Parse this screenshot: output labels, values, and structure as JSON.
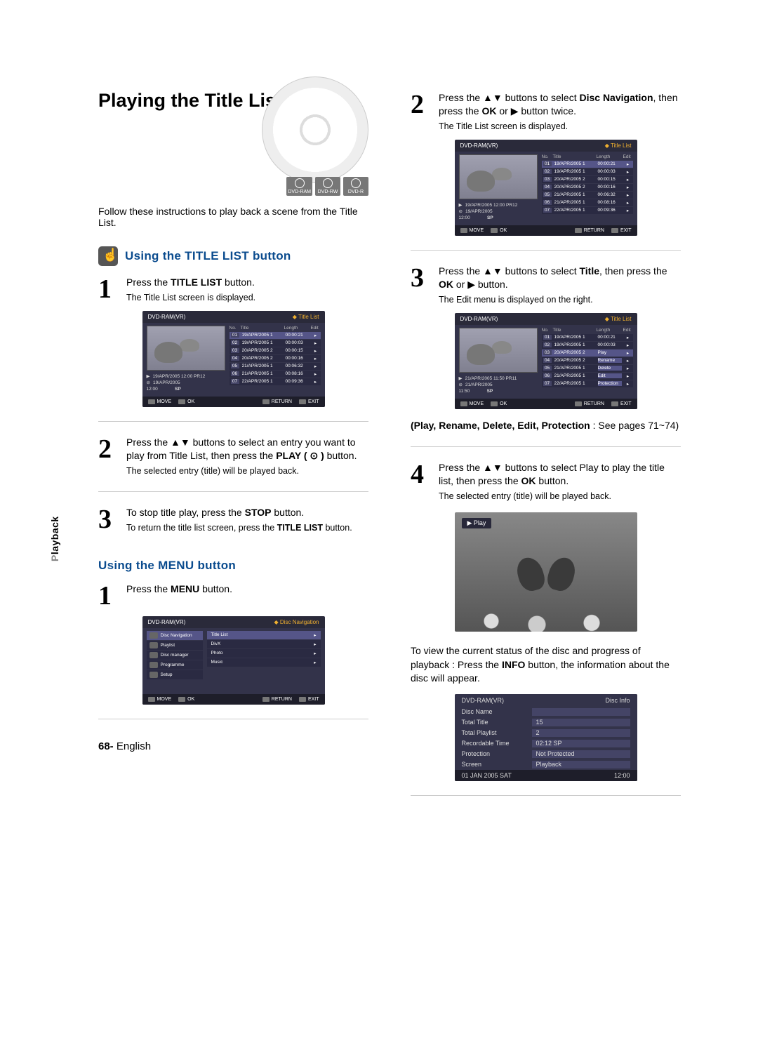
{
  "sideTab": {
    "faded": "P",
    "active": "layback"
  },
  "pageTitle": "Playing the Title List",
  "badges": [
    "DVD-RAM",
    "DVD-RW",
    "DVD-R"
  ],
  "intro": "Follow these instructions to play back a scene from the Title List.",
  "sectionA": "Using the TITLE LIST button",
  "sectionB": "Using the MENU button",
  "pageFooter": {
    "num": "68-",
    "lang": "English"
  },
  "col1": {
    "step1": {
      "num": "1",
      "text_pre": "Press the ",
      "text_bold": "TITLE LIST",
      "text_post": " button.",
      "sub": "The Title List screen is displayed."
    },
    "step2": {
      "num": "2",
      "text": "Press the ▲▼ buttons to select an entry you want to play from Title List, then press the ",
      "bold": "PLAY ( ⊙ )",
      "text2": " button.",
      "sub": "The selected entry (title) will be played back."
    },
    "step3": {
      "num": "3",
      "text": "To stop title play, press the ",
      "bold": "STOP",
      "text2": " button.",
      "sub_pre": "To return the title list screen, press the ",
      "sub_bold": "TITLE LIST",
      "sub_post": " button."
    },
    "stepB1": {
      "num": "1",
      "text": "Press the ",
      "bold": "MENU",
      "text2": " button."
    }
  },
  "col2": {
    "step2": {
      "num": "2",
      "text": "Press the ▲▼ buttons to select ",
      "bold1": "Disc Navigation",
      "mid": ", then press the ",
      "bold2": "OK",
      "text2": " or ▶ button twice.",
      "sub": "The Title List screen is displayed."
    },
    "step3": {
      "num": "3",
      "text": "Press the ▲▼ buttons to select ",
      "bold1": "Title",
      "mid": ", then press the ",
      "bold2": "OK",
      "text2": " or ▶ button.",
      "sub": "The Edit menu is displayed on the right."
    },
    "note": {
      "bold": "(Play, Rename, Delete, Edit, Protection",
      "rest": " : See pages 71~74)"
    },
    "step4": {
      "num": "4",
      "text": "Press the ▲▼ buttons to select Play to play the title list, then press the ",
      "bold": "OK",
      "text2": " button.",
      "sub": "The selected entry (title) will be played back."
    },
    "playLabel": "▶ Play",
    "infoNote": "To view the current status of the disc and progress of playback : Press the ",
    "infoBold": "INFO",
    "infoNote2": " button, the information about the disc will appear."
  },
  "titlelist_ui": {
    "header_left": "DVD-RAM(VR)",
    "header_right": "Title List",
    "list_head": {
      "no": "No.",
      "title": "Title",
      "length": "Length",
      "edit": "Edit"
    },
    "meta": {
      "line1": "19/APR/2005 12:00 PR12",
      "line2": "19/APR/2005",
      "line3_a": "12:00",
      "line3_b": "SP"
    },
    "rows": [
      {
        "n": "01",
        "t": "19/APR/2005 1",
        "l": "00:00:21",
        "sel": true
      },
      {
        "n": "02",
        "t": "19/APR/2005 1",
        "l": "00:00:03"
      },
      {
        "n": "03",
        "t": "20/APR/2005 2",
        "l": "00:00:15"
      },
      {
        "n": "04",
        "t": "20/APR/2005 2",
        "l": "00:00:16"
      },
      {
        "n": "05",
        "t": "21/APR/2005 1",
        "l": "00:06:32"
      },
      {
        "n": "06",
        "t": "21/APR/2005 1",
        "l": "00:08:16"
      },
      {
        "n": "07",
        "t": "22/APR/2005 1",
        "l": "00:09:36"
      }
    ],
    "footer": {
      "move": "MOVE",
      "ok": "OK",
      "ret": "RETURN",
      "exit": "EXIT"
    }
  },
  "titlelist_ui_edit": {
    "header_left": "DVD-RAM(VR)",
    "header_right": "Title List",
    "meta": {
      "line1": "21/APR/2005 11:50 PR11",
      "line2": "21/APR/2005",
      "line3_a": "11:50",
      "line3_b": "SP"
    },
    "rows": [
      {
        "n": "01",
        "t": "19/APR/2005 1",
        "l": "00:00:21"
      },
      {
        "n": "02",
        "t": "19/APR/2005 1",
        "l": "00:00:03"
      },
      {
        "n": "03",
        "t": "20/APR/2005 2",
        "l": "Play",
        "edit": true,
        "sel": true
      },
      {
        "n": "04",
        "t": "20/APR/2005 2",
        "l": "Rename",
        "edit": true
      },
      {
        "n": "05",
        "t": "21/APR/2005 1",
        "l": "Delete",
        "edit": true
      },
      {
        "n": "06",
        "t": "21/APR/2005 1",
        "l": "Edit",
        "edit": true
      },
      {
        "n": "07",
        "t": "22/APR/2005 1",
        "l": "Protection",
        "edit": true
      }
    ]
  },
  "discnav_ui": {
    "header_left": "DVD-RAM(VR)",
    "header_right": "Disc Navigation",
    "left": [
      {
        "label": "Disc Navigation",
        "sel": true
      },
      {
        "label": "Playlist"
      },
      {
        "label": "Disc manager"
      },
      {
        "label": "Programme"
      },
      {
        "label": "Setup"
      }
    ],
    "right": [
      {
        "label": "Title List",
        "sel": true
      },
      {
        "label": "DivX"
      },
      {
        "label": "Photo"
      },
      {
        "label": "Music"
      }
    ],
    "footer": {
      "move": "MOVE",
      "ok": "OK",
      "ret": "RETURN",
      "exit": "EXIT"
    }
  },
  "discinfo_ui": {
    "header_left": "DVD-RAM(VR)",
    "header_right": "Disc Info",
    "rows": [
      {
        "lab": "Disc Name",
        "val": ""
      },
      {
        "lab": "Total Title",
        "val": "15"
      },
      {
        "lab": "Total Playlist",
        "val": "2"
      },
      {
        "lab": "Recordable Time",
        "val": "02:12  SP"
      },
      {
        "lab": "Protection",
        "val": "Not Protected"
      },
      {
        "lab": "Screen",
        "val": "Playback"
      }
    ],
    "foot_left": "01 JAN 2005 SAT",
    "foot_right": "12:00"
  }
}
